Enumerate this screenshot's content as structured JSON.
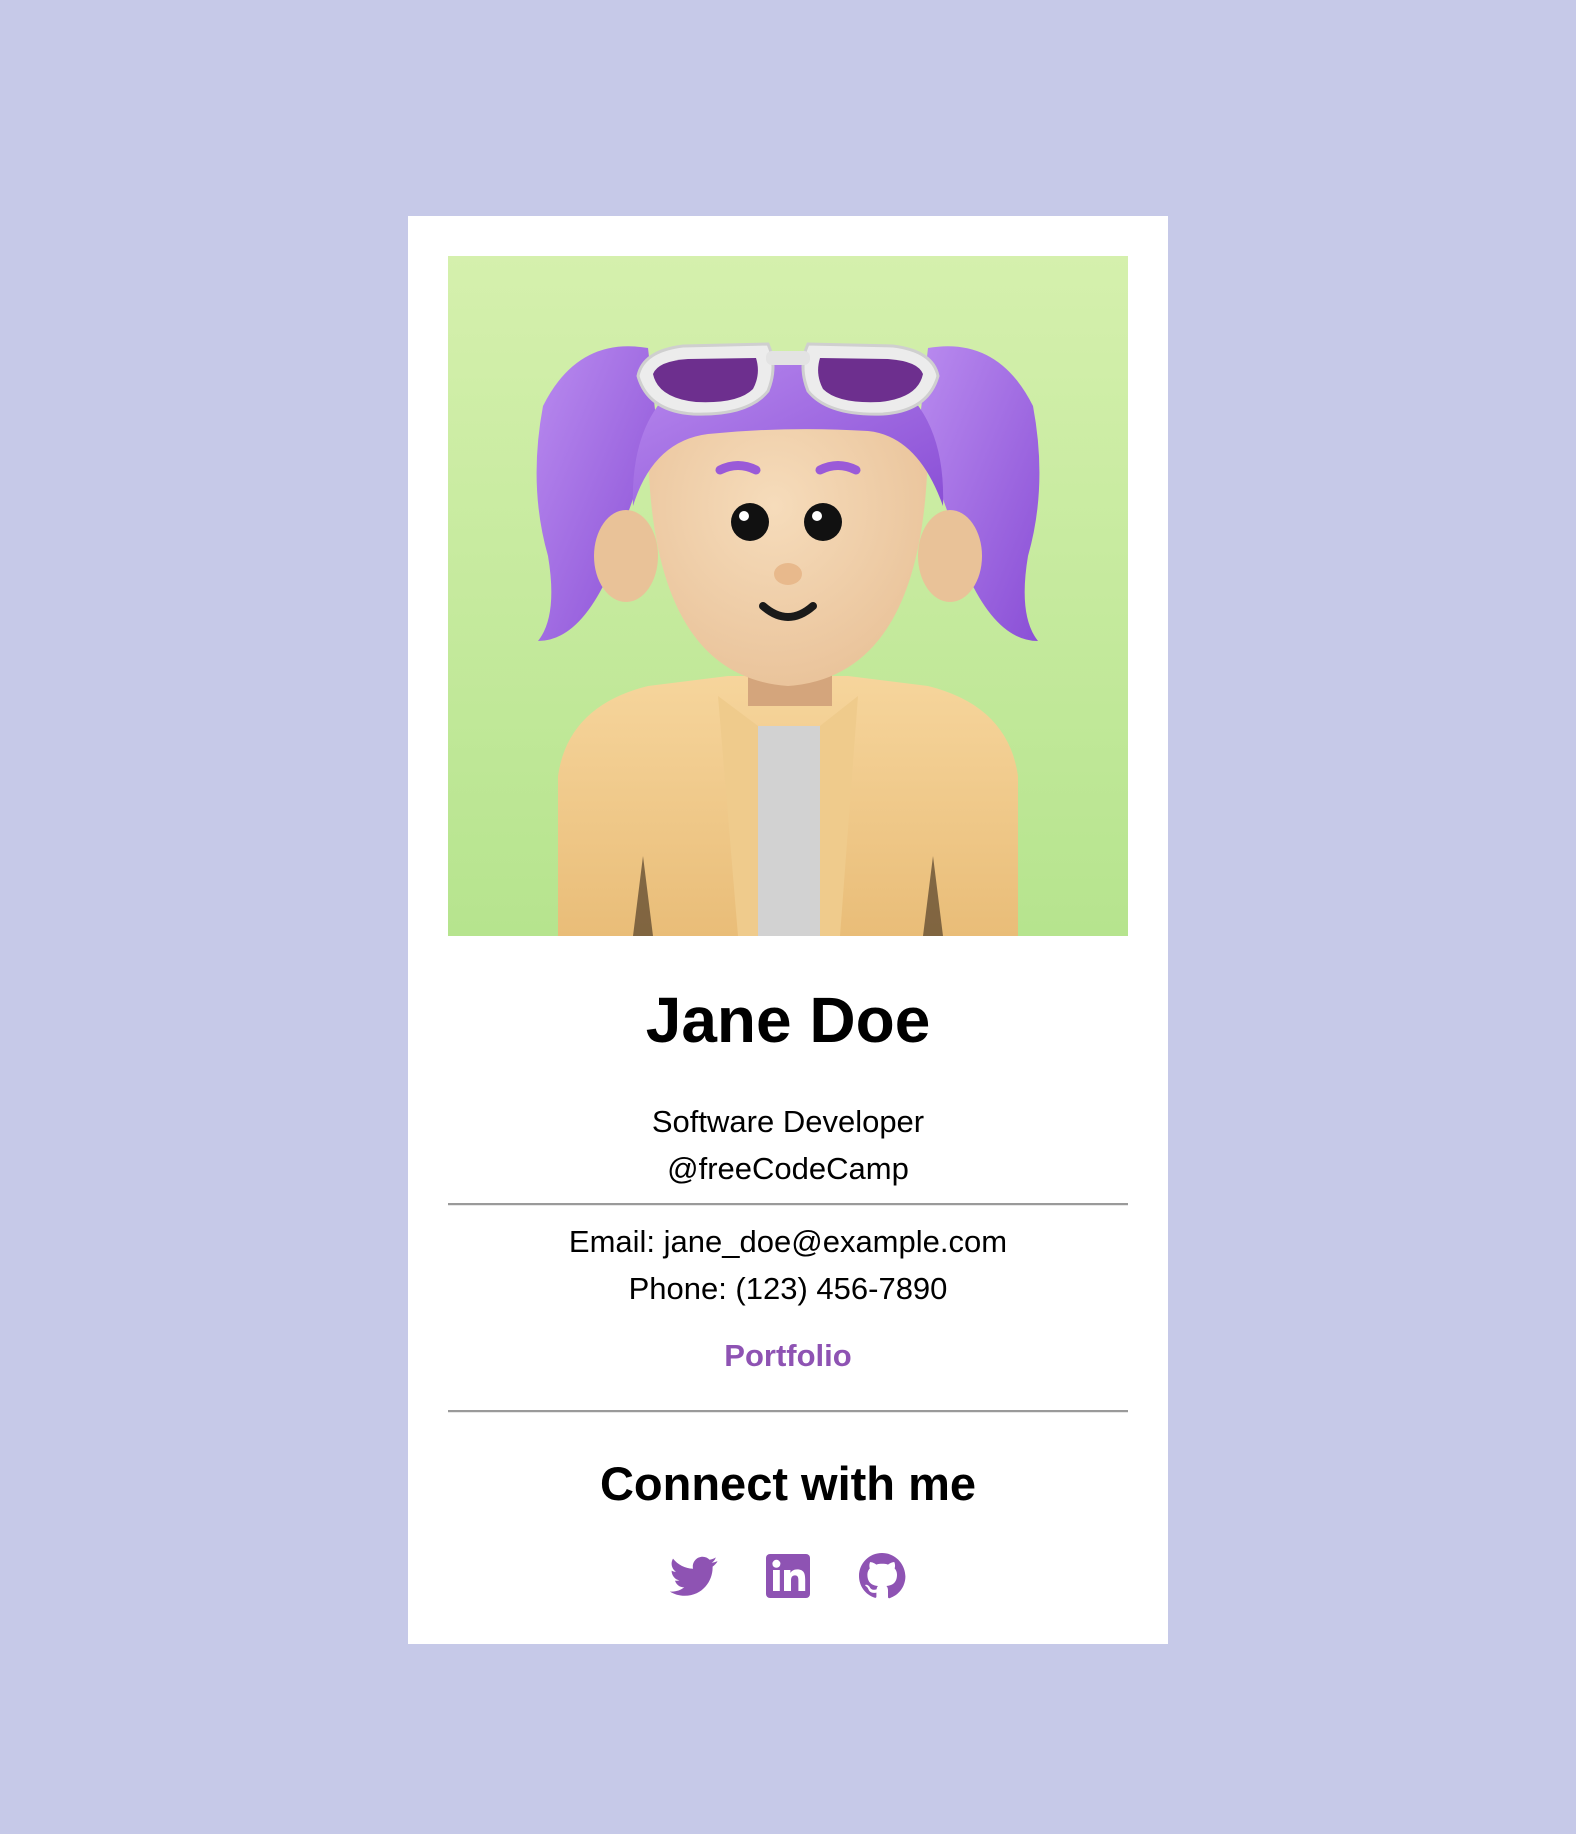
{
  "profile": {
    "name": "Jane Doe",
    "role_line1": "Software Developer",
    "role_line2": "@freeCodeCamp",
    "email": "Email: jane_doe@example.com",
    "phone": "Phone: (123) 456-7890",
    "portfolio_label": "Portfolio"
  },
  "connect": {
    "heading": "Connect with me",
    "icons": [
      "twitter-icon",
      "linkedin-icon",
      "github-icon"
    ]
  },
  "colors": {
    "page_background": "#c6c9e8",
    "card_background": "#ffffff",
    "accent": "#8e53b3"
  }
}
